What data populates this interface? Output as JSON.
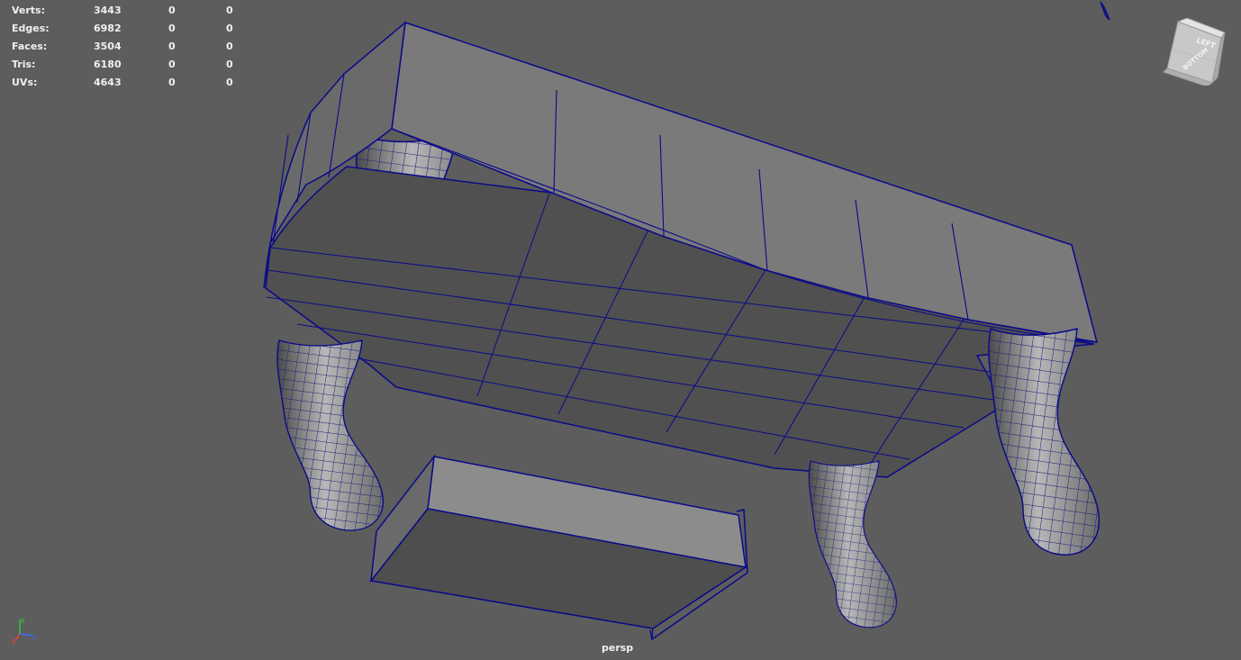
{
  "viewport": {
    "camera": "persp",
    "background": "#5d5d5d",
    "wire_color": "#0a0a8a"
  },
  "heads_up": {
    "rows": [
      {
        "label": "Verts:",
        "v1": "3443",
        "v2": "0",
        "v3": "0"
      },
      {
        "label": "Edges:",
        "v1": "6982",
        "v2": "0",
        "v3": "0"
      },
      {
        "label": "Faces:",
        "v1": "3504",
        "v2": "0",
        "v3": "0"
      },
      {
        "label": "Tris:",
        "v1": "6180",
        "v2": "0",
        "v3": "0"
      },
      {
        "label": "UVs:",
        "v1": "4643",
        "v2": "0",
        "v3": "0"
      }
    ]
  },
  "view_cube": {
    "face_left": "LEFT",
    "face_bottom": "BOTTOM"
  },
  "axes": {
    "x": "x",
    "y": "y",
    "z": "z"
  }
}
